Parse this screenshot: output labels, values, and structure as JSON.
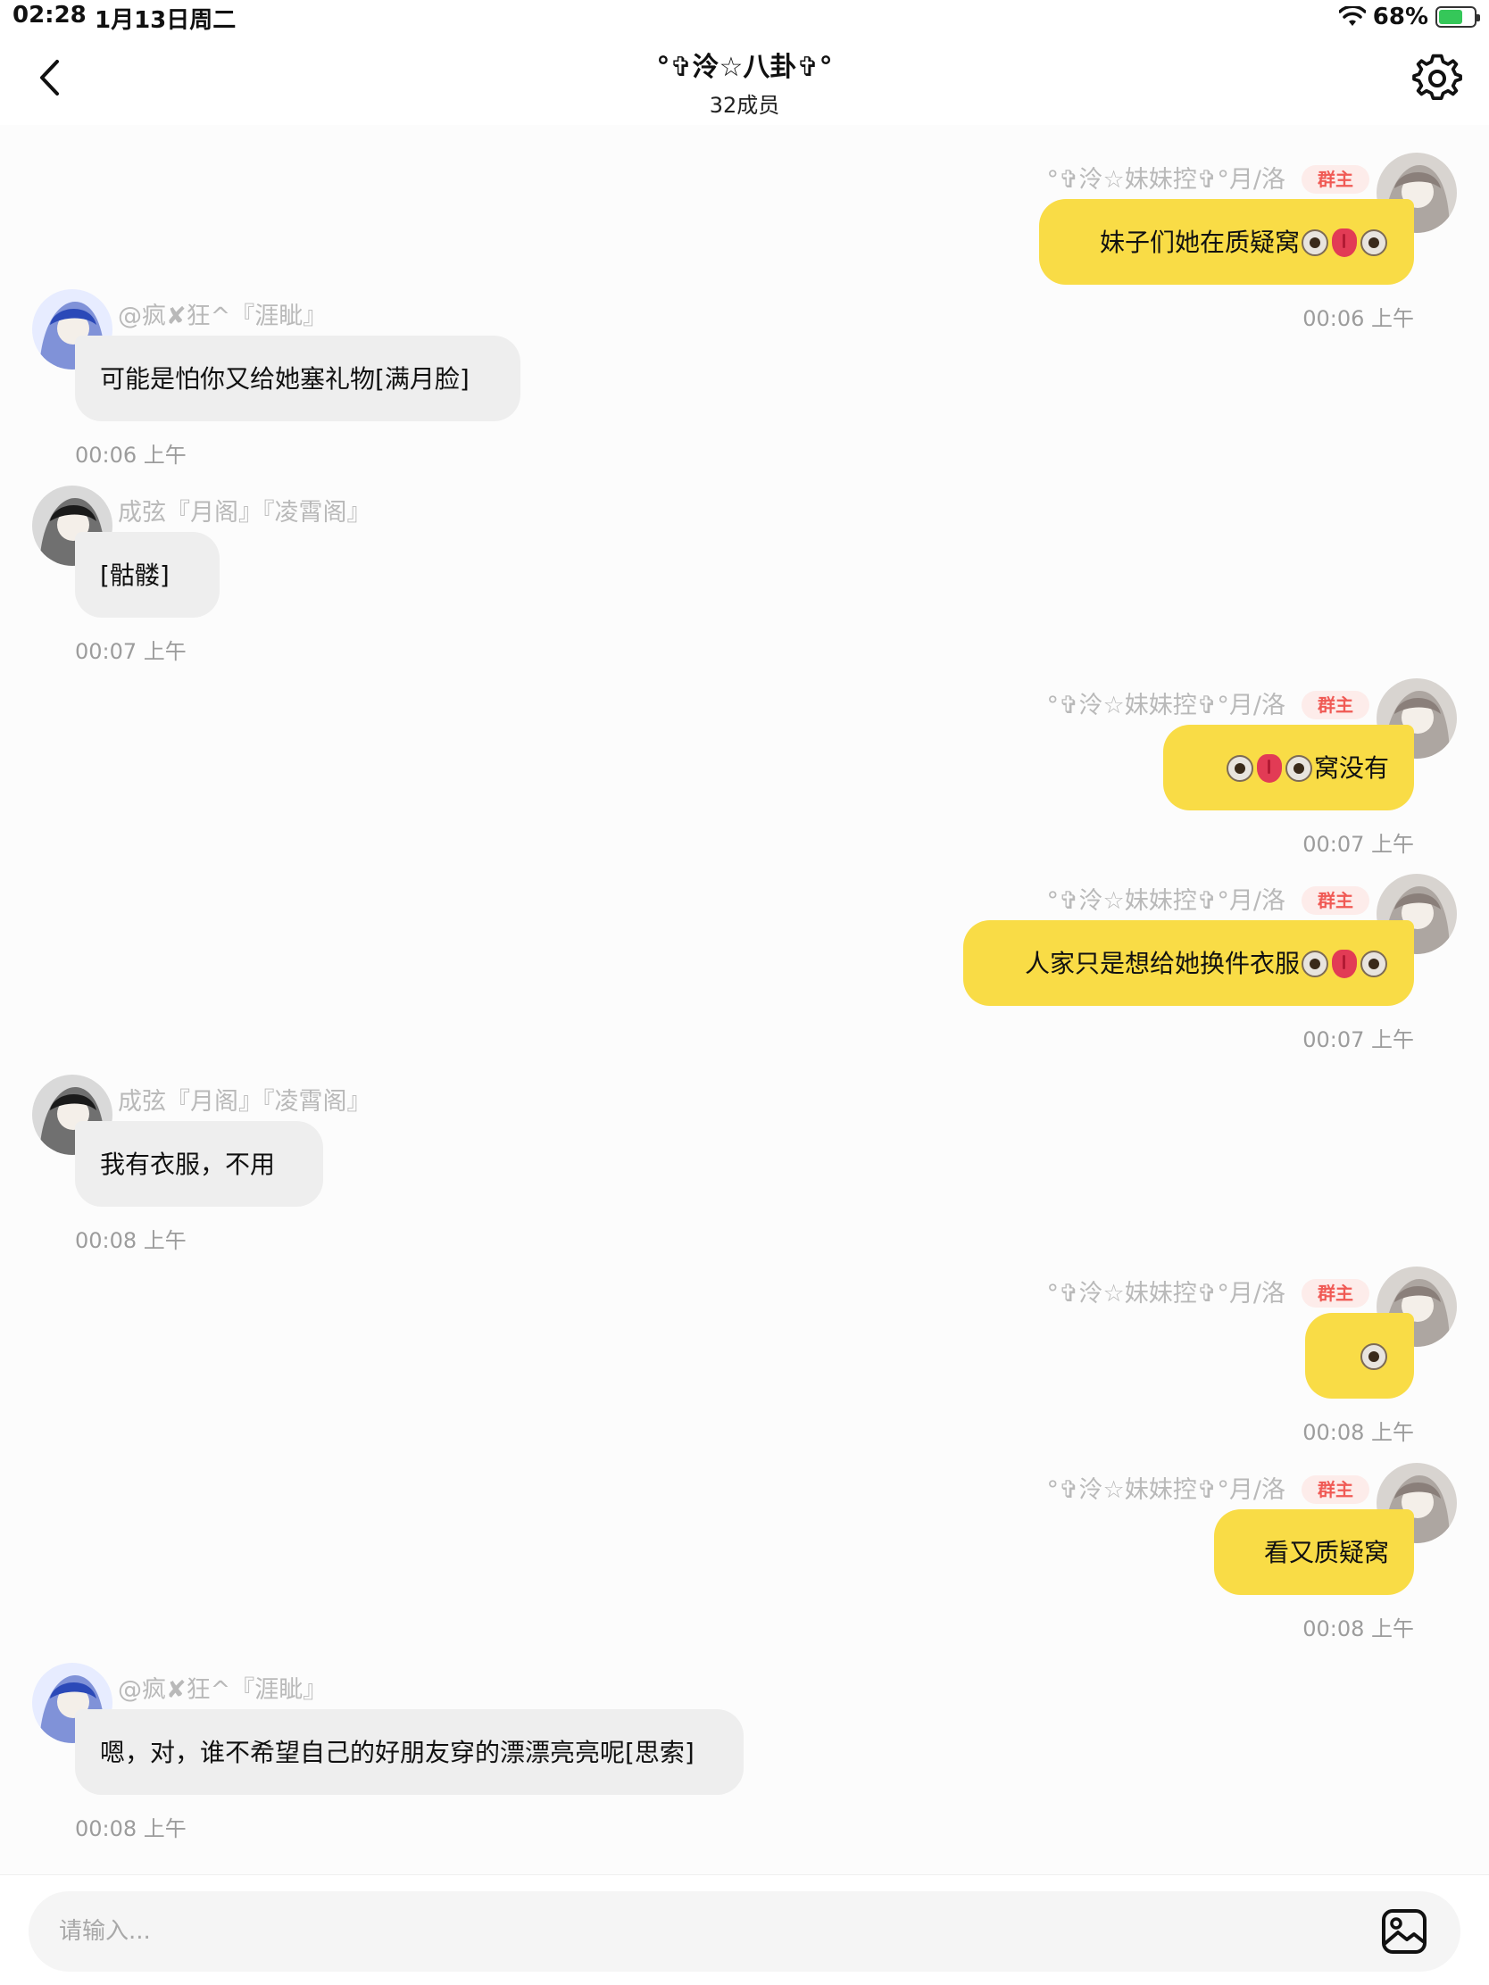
{
  "status_bar": {
    "time": "02:28",
    "date": "1月13日周二",
    "battery": "68%",
    "battery_level": 0.68
  },
  "header": {
    "title": "°✞泠☆八卦✞°",
    "members": "32成员"
  },
  "messages": [
    {
      "side": "self",
      "sender": "°✞泠☆妹妹控✞°月/洛",
      "badge": "群主",
      "text": "妹子们她在质疑窝",
      "emoji": [
        "eye",
        "tongue",
        "eye"
      ],
      "time": "00:06 上午"
    },
    {
      "side": "other",
      "sender": "@疯✘狂^『涯眦』",
      "text": "可能是怕你又给她塞礼物[满月脸]",
      "time": "00:06 上午"
    },
    {
      "side": "other",
      "sender": "成弦『月阁』『凌霄阁』",
      "text": "[骷髅]",
      "time": "00:07 上午"
    },
    {
      "side": "self",
      "sender": "°✞泠☆妹妹控✞°月/洛",
      "badge": "群主",
      "text": "窝没有",
      "emoji_before": [
        "eye",
        "tongue",
        "eye"
      ],
      "time": "00:07 上午"
    },
    {
      "side": "self",
      "sender": "°✞泠☆妹妹控✞°月/洛",
      "badge": "群主",
      "text": "人家只是想给她换件衣服",
      "emoji": [
        "eye",
        "tongue",
        "eye"
      ],
      "time": "00:07 上午"
    },
    {
      "side": "other",
      "sender": "成弦『月阁』『凌霄阁』",
      "text": "我有衣服，不用",
      "time": "00:08 上午"
    },
    {
      "side": "self",
      "sender": "°✞泠☆妹妹控✞°月/洛",
      "badge": "群主",
      "text": "",
      "emoji": [
        "eye"
      ],
      "time": "00:08 上午"
    },
    {
      "side": "self",
      "sender": "°✞泠☆妹妹控✞°月/洛",
      "badge": "群主",
      "text": "看又质疑窝",
      "time": "00:08 上午"
    },
    {
      "side": "other",
      "sender": "@疯✘狂^『涯眦』",
      "text": "嗯，对，谁不希望自己的好朋友穿的漂漂亮亮呢[思索]",
      "time": "00:08 上午"
    }
  ],
  "input": {
    "placeholder": "请输入..."
  },
  "icons": {
    "back": "chevron-left-icon",
    "settings": "gear-icon",
    "image": "image-icon"
  },
  "colors": {
    "self_bubble": "#f9dc46",
    "other_bubble": "#eeeeee",
    "badge_bg": "#fdecea",
    "badge_text": "#f05a55"
  }
}
